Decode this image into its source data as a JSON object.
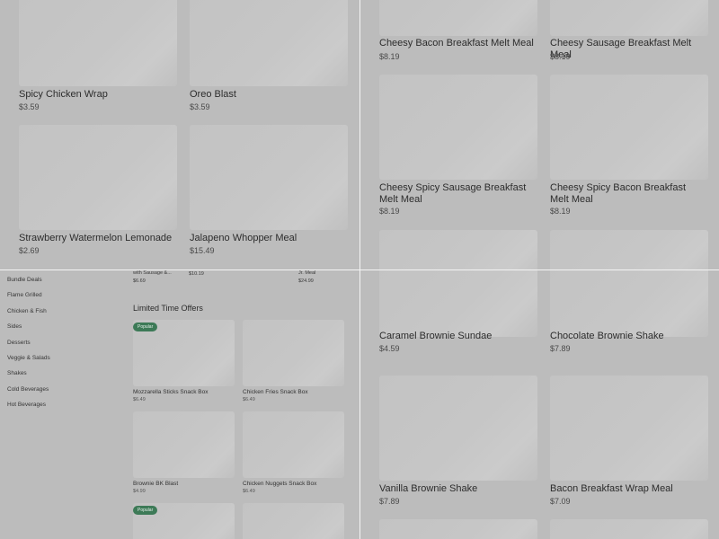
{
  "panels": {
    "top_left": [
      {
        "name": "Spicy Chicken Wrap",
        "price": "$3.59"
      },
      {
        "name": "Oreo Blast",
        "price": "$3.59"
      },
      {
        "name": "Strawberry Watermelon Lemonade",
        "price": "$2.69"
      },
      {
        "name": "Jalapeno Whopper Meal",
        "price": "$15.49"
      }
    ],
    "top_right": [
      {
        "name": "Cheesy Bacon Breakfast Melt Meal",
        "price": "$8.19"
      },
      {
        "name": "Cheesy Sausage Breakfast Melt Meal",
        "price": "$8.19"
      },
      {
        "name": "Cheesy Spicy Sausage Breakfast Melt Meal",
        "price": "$8.19"
      },
      {
        "name": "Cheesy Spicy Bacon Breakfast Melt Meal",
        "price": "$8.19"
      }
    ],
    "bottom_right": [
      {
        "name": "Caramel Brownie Sundae",
        "price": "$4.59"
      },
      {
        "name": "Chocolate Brownie Shake",
        "price": "$7.89"
      },
      {
        "name": "Vanilla Brownie Shake",
        "price": "$7.89"
      },
      {
        "name": "Bacon Breakfast Wrap Meal",
        "price": "$7.09"
      }
    ],
    "bottom_left": {
      "sidebar": [
        "Bundle Deals",
        "Flame Grilled",
        "Chicken & Fish",
        "Sides",
        "Desserts",
        "Veggie & Salads",
        "Shakes",
        "Cold Beverages",
        "Hot Beverages"
      ],
      "prev_row": [
        {
          "name": "with Sausage &...",
          "price": "$6.69"
        },
        {
          "name": "",
          "price": "$10.19"
        },
        {
          "name": "Jr. Meal",
          "price": "$24.99"
        }
      ],
      "section_title": "Limited Time Offers",
      "badge": "Popular",
      "items": [
        {
          "name": "Mozzarella Sticks Snack Box",
          "price": "$6.49"
        },
        {
          "name": "Chicken Fries Snack Box",
          "price": "$6.49"
        },
        {
          "name": "Brownie BK Blast",
          "price": "$4.99"
        },
        {
          "name": "Chicken Nuggets Snack Box",
          "price": "$6.49"
        }
      ]
    }
  }
}
